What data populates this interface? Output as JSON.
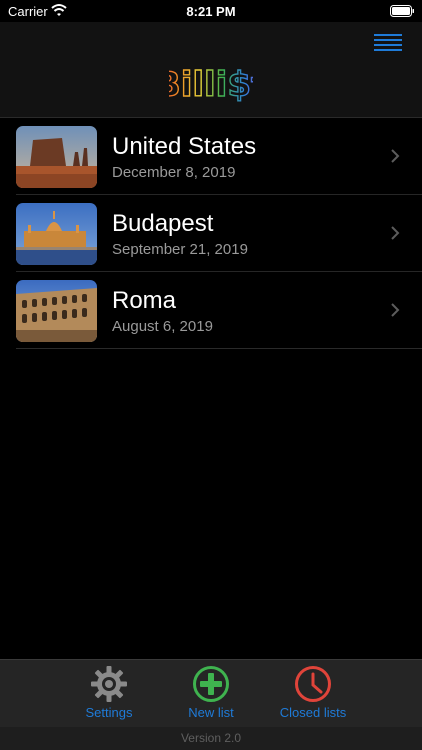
{
  "status_bar": {
    "carrier": "Carrier",
    "time": "8:21 PM"
  },
  "header": {
    "logo_text": "Billi$t"
  },
  "lists": [
    {
      "title": "United States",
      "date": "December 8, 2019",
      "thumbnail": "monument-valley"
    },
    {
      "title": "Budapest",
      "date": "September 21, 2019",
      "thumbnail": "budapest-parliament"
    },
    {
      "title": "Roma",
      "date": "August 6, 2019",
      "thumbnail": "colosseum"
    }
  ],
  "tab_bar": {
    "settings_label": "Settings",
    "new_list_label": "New list",
    "closed_lists_label": "Closed lists"
  },
  "footer": {
    "version": "Version 2.0"
  },
  "colors": {
    "accent": "#1f7bd8",
    "new_list": "#3fb34f",
    "closed_lists": "#e0443a"
  }
}
